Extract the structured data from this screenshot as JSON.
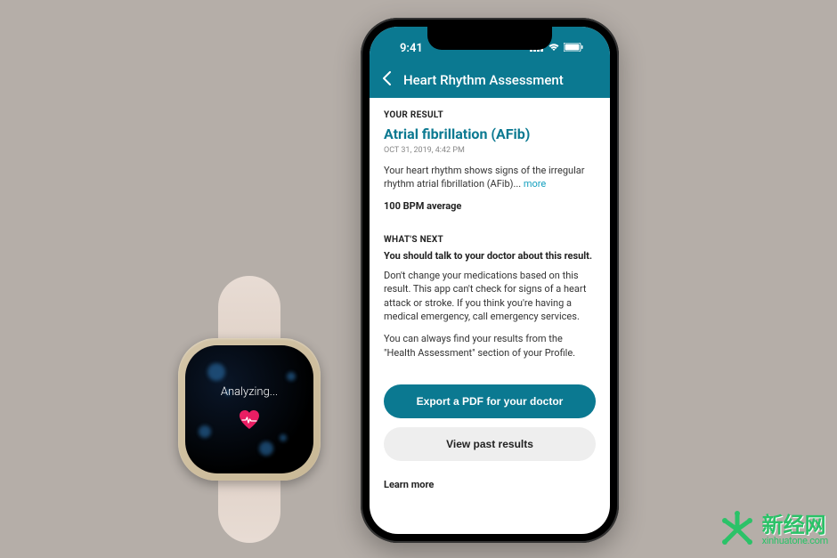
{
  "watch": {
    "status_text": "Analyzing..."
  },
  "phone": {
    "status_bar": {
      "time": "9:41"
    },
    "header": {
      "title": "Heart Rhythm Assessment"
    },
    "result": {
      "section_label": "YOUR RESULT",
      "diagnosis": "Atrial fibrillation (AFib)",
      "timestamp": "OCT 31, 2019, 4:42 PM",
      "description_prefix": "Your heart rhythm shows signs of the irregular rhythm atrial fibrillation (AFib)... ",
      "more_link": "more",
      "bpm": "100 BPM average"
    },
    "next": {
      "section_label": "WHAT'S NEXT",
      "advice_headline": "You should talk to your doctor about this result.",
      "advice_body": "Don't change your medications based on this result. This app can't check for signs of a heart attack or stroke. If you think you're having a medical emergency, call emergency services.",
      "advice_archive": "You can always find your results from the \"Health Assessment\" section of your Profile."
    },
    "buttons": {
      "export_pdf": "Export a PDF for your doctor",
      "view_past": "View past results"
    },
    "learn_more": "Learn more"
  },
  "watermark": {
    "brand_cn": "新经网",
    "brand_en": "xinhuatone.com"
  }
}
